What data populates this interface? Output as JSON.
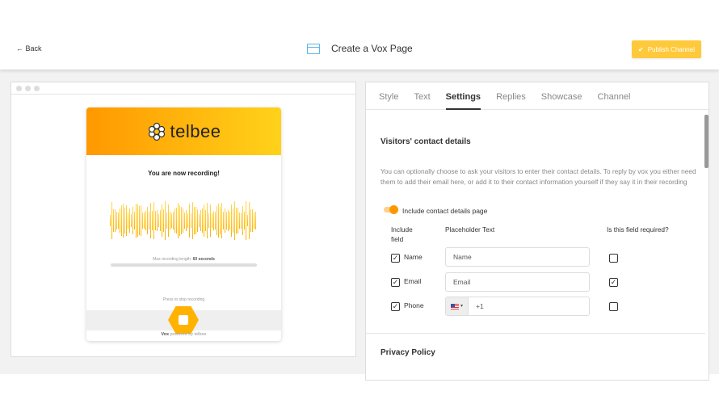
{
  "header": {
    "back_label": "← Back",
    "title": "Create a Vox Page",
    "publish_label": "Publish Channel"
  },
  "preview": {
    "brand": "telbee",
    "recording_title": "You are now recording!",
    "max_length_label": "Max recording length:",
    "max_length_value": "60 seconds",
    "press_label": "Press to stop recording",
    "powered_brand": "Vox",
    "powered_text": "powered by telbee",
    "progress": 0
  },
  "tabs": [
    {
      "label": "Style"
    },
    {
      "label": "Text"
    },
    {
      "label": "Settings",
      "active": true
    },
    {
      "label": "Replies"
    },
    {
      "label": "Showcase"
    },
    {
      "label": "Channel"
    }
  ],
  "settings": {
    "section_title": "Visitors' contact details",
    "description": "You can optionally choose to ask your visitors to enter their contact details. To reply by vox you either need them to add their email here, or add it to their contact information yourself if they say it in their recording",
    "toggle_label": "Include contact details page",
    "toggle_on": true,
    "col_include": "Include field",
    "col_placeholder": "Placeholder Text",
    "col_required": "Is this field required?",
    "fields": [
      {
        "label": "Name",
        "include": true,
        "placeholder": "Name",
        "required": false
      },
      {
        "label": "Email",
        "include": true,
        "placeholder": "Email",
        "required": true
      },
      {
        "label": "Phone",
        "include": true,
        "placeholder": "+1",
        "required": false,
        "flag": "US"
      }
    ],
    "next_section": "Privacy Policy"
  },
  "colors": {
    "accent": "#ff9800",
    "publish": "#ffc93c"
  }
}
